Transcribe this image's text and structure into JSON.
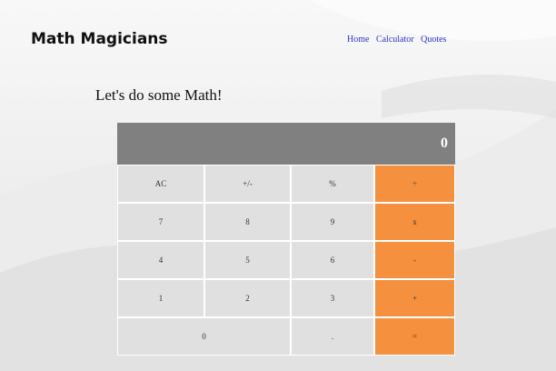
{
  "header": {
    "brand": "Math Magicians",
    "nav": [
      "Home",
      "Calculator",
      "Quotes"
    ]
  },
  "main": {
    "heading": "Let's do some Math!"
  },
  "calculator": {
    "display": "0",
    "keys": [
      "AC",
      "+/-",
      "%",
      "÷",
      "7",
      "8",
      "9",
      "x",
      "4",
      "5",
      "6",
      "-",
      "1",
      "2",
      "3",
      "+",
      "0",
      ".",
      "="
    ]
  },
  "colors": {
    "operator": "#f5913e",
    "key": "#e0e0e0",
    "display": "#808080",
    "nav_link": "#2a35c8"
  }
}
